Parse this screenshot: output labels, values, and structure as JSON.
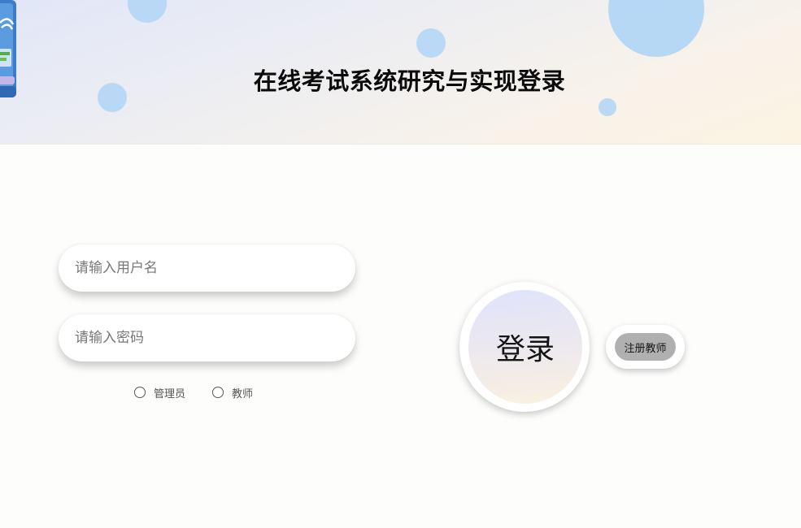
{
  "header": {
    "title": "在线考试系统研究与实现登录",
    "logo_icon": "exam-system-logo-icon"
  },
  "form": {
    "username_placeholder": "请输入用户名",
    "username_value": "",
    "password_placeholder": "请输入密码",
    "password_value": "",
    "roles": [
      {
        "label": "管理员",
        "selected": false
      },
      {
        "label": "教师",
        "selected": false
      }
    ]
  },
  "actions": {
    "login_label": "登录",
    "register_label": "注册教师"
  },
  "colors": {
    "bubble": "#b2d6f6",
    "register_button": "#b0b0b0",
    "banner_start": "#e1e6f8",
    "banner_end": "#fcf3e2"
  }
}
